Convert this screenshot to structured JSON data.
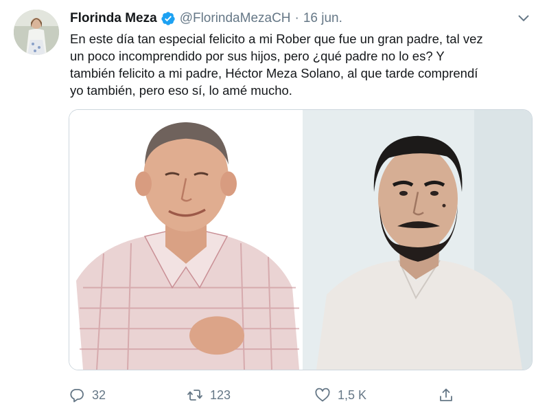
{
  "tweet": {
    "author": {
      "display_name": "Florinda Meza",
      "handle": "@FlorindaMezaCH",
      "verified": true
    },
    "separator": "·",
    "date": "16 jun.",
    "text_lines": [
      "En este día tan especial felicito a mi Rober que fue un gran padre, tal vez",
      "un poco incomprendido por sus hijos, pero ¿qué padre no lo es? Y",
      "también felicito a mi padre, Héctor Meza Solano, al que tarde comprendí",
      "yo también, pero eso sí, lo amé mucho."
    ],
    "media": {
      "count": 2
    },
    "actions": {
      "replies": "32",
      "retweets": "123",
      "likes": "1,5 K"
    }
  },
  "colors": {
    "text": "#14171a",
    "secondary_text": "#657786",
    "verified_blue": "#1da1f2",
    "border": "#ccd6dd"
  },
  "icons": [
    "verified-badge-icon",
    "chevron-down-icon",
    "reply-icon",
    "retweet-icon",
    "like-icon",
    "share-icon"
  ]
}
